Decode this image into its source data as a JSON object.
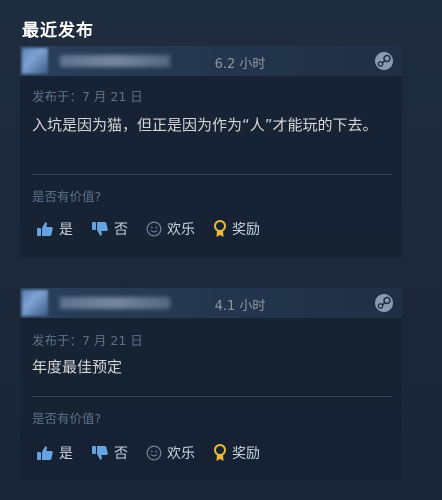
{
  "section": {
    "title": "最近发布"
  },
  "reviews": [
    {
      "hours": "6.2 小时",
      "posted": "发布于：7 月 21 日",
      "content": "入坑是因为猫，但正是因为作为“人”才能玩的下去。",
      "helpful_question": "是否有价值?",
      "buttons": {
        "yes": "是",
        "no": "否",
        "funny": "欢乐",
        "award": "奖励"
      }
    },
    {
      "hours": "4.1 小时",
      "posted": "发布于：7 月 21 日",
      "content": "年度最佳预定",
      "helpful_question": "是否有价值?",
      "buttons": {
        "yes": "是",
        "no": "否",
        "funny": "欢乐",
        "award": "奖励"
      }
    }
  ],
  "colors": {
    "background": "#1b2838",
    "header": "#2a3f5a",
    "text_primary": "#d6d7d8",
    "text_muted": "#5c7189",
    "award": "#e8b93a"
  }
}
